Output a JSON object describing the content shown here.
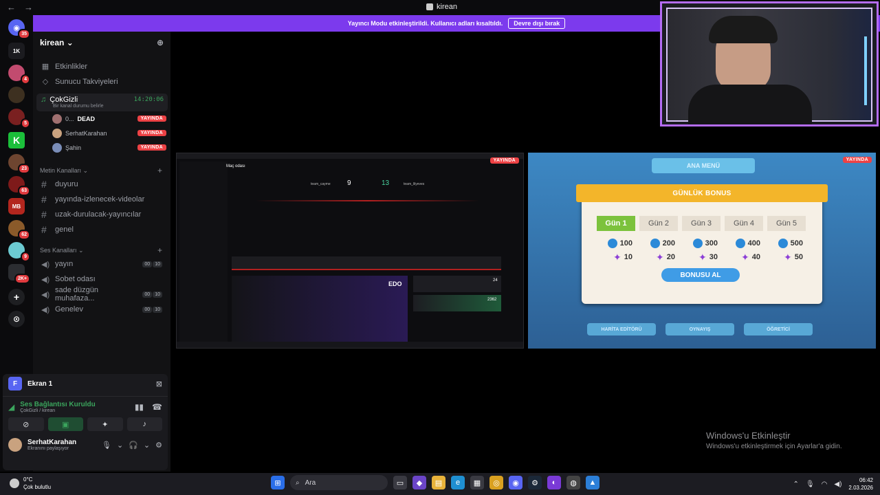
{
  "window": {
    "title": "kirean",
    "nav_back": "←",
    "nav_forward": "→"
  },
  "notice": {
    "text": "Yayıncı Modu etkinleştirildi. Kullanıcı adları kısaltıldı.",
    "button": "Devre dışı bırak"
  },
  "rail": {
    "guilds": [
      {
        "label": "",
        "badge": "35",
        "color": "#5865f2"
      },
      {
        "label": "1K",
        "badge": "",
        "color": "#222"
      },
      {
        "label": "",
        "badge": "4",
        "color": "#c24b6f"
      },
      {
        "label": "",
        "badge": "",
        "color": "#3d3020"
      },
      {
        "label": "",
        "badge": "5",
        "color": "#7a2020"
      },
      {
        "label": "K",
        "badge": "",
        "color": "#2fcf46"
      },
      {
        "label": "",
        "badge": "23",
        "color": "#6e4530"
      },
      {
        "label": "",
        "badge": "63",
        "color": "#7e1a1a"
      },
      {
        "label": "MB",
        "badge": "",
        "color": "#b3261e"
      },
      {
        "label": "",
        "badge": "62",
        "color": "#8a5a2a"
      },
      {
        "label": "",
        "badge": "9",
        "color": "#6ccad1"
      },
      {
        "label": "",
        "badge": "2K+",
        "color": "#2b2d31"
      }
    ],
    "add": "+",
    "discover": "⊙"
  },
  "server": {
    "name": "kirean ⌄"
  },
  "side_items": [
    {
      "label": "Etkinlikler"
    },
    {
      "label": "Sunucu Takviyeleri"
    }
  ],
  "active_voice": {
    "name": "ÇokGizli",
    "time": "14:20:06",
    "status_hint": "Bir kanal durumu belirle",
    "members": [
      {
        "name": "0...",
        "extra": "DEAD",
        "live": "YAYINDA"
      },
      {
        "name": "SerhatKarahan",
        "extra": "",
        "live": "YAYINDA"
      },
      {
        "name": "Şahin",
        "extra": "",
        "live": "YAYINDA"
      }
    ]
  },
  "text_category": {
    "label": "Metin Kanalları ⌄",
    "add": "+"
  },
  "text_channels": [
    {
      "name": "duyuru"
    },
    {
      "name": "yayında-izlenecek-videolar"
    },
    {
      "name": "uzak-durulacak-yayıncılar"
    },
    {
      "name": "genel"
    }
  ],
  "voice_category": {
    "label": "Ses Kanalları ⌄",
    "add": "+"
  },
  "voice_channels": [
    {
      "name": "yayın",
      "v1": "00",
      "v2": "10"
    },
    {
      "name": "Sobet odası",
      "v1": "",
      "v2": ""
    },
    {
      "name": "sade düzgün muhafaza...",
      "v1": "00",
      "v2": "10"
    },
    {
      "name": "Genelev",
      "v1": "00",
      "v2": "10"
    }
  ],
  "panel": {
    "stream_icon": "F",
    "stream_label": "Ekran 1",
    "voice_status": "Ses Bağlantısı Kuruldu",
    "voice_sub": "ÇokGizli / kirean",
    "user_name": "SerhatKarahan",
    "user_status": "Ekranını paylaşıyor"
  },
  "streams": {
    "live_label": "YAYINDA",
    "left": {
      "room_title": "Maç odası",
      "score_left": "9",
      "score_right": "13",
      "team_left": "team_cayme",
      "team_right": "team_lilyeves",
      "card_label": "EDO",
      "stat1": "24",
      "stat2": "2362"
    }
  },
  "game": {
    "menu": "ANA MENÜ",
    "title": "GÜNLÜK BONUS",
    "days": [
      {
        "label": "Gün 1",
        "coins": "100",
        "stars": "10"
      },
      {
        "label": "Gün 2",
        "coins": "200",
        "stars": "20"
      },
      {
        "label": "Gün 3",
        "coins": "300",
        "stars": "30"
      },
      {
        "label": "Gün 4",
        "coins": "400",
        "stars": "40"
      },
      {
        "label": "Gün 5",
        "coins": "500",
        "stars": "50"
      }
    ],
    "claim": "BONUSU AL",
    "bottom_buttons": [
      "HARİTA EDİTÖRÜ",
      "OYNAYIŞ",
      "ÖĞRETİCİ"
    ]
  },
  "watermark": {
    "line1": "Windows'u Etkinleştir",
    "line2": "Windows'u etkinleştirmek için Ayarlar'a gidin."
  },
  "taskbar": {
    "temp": "0°C",
    "weather": "Çok bulutlu",
    "search": "Ara",
    "time": "06:42",
    "date": "2.03.2026"
  }
}
